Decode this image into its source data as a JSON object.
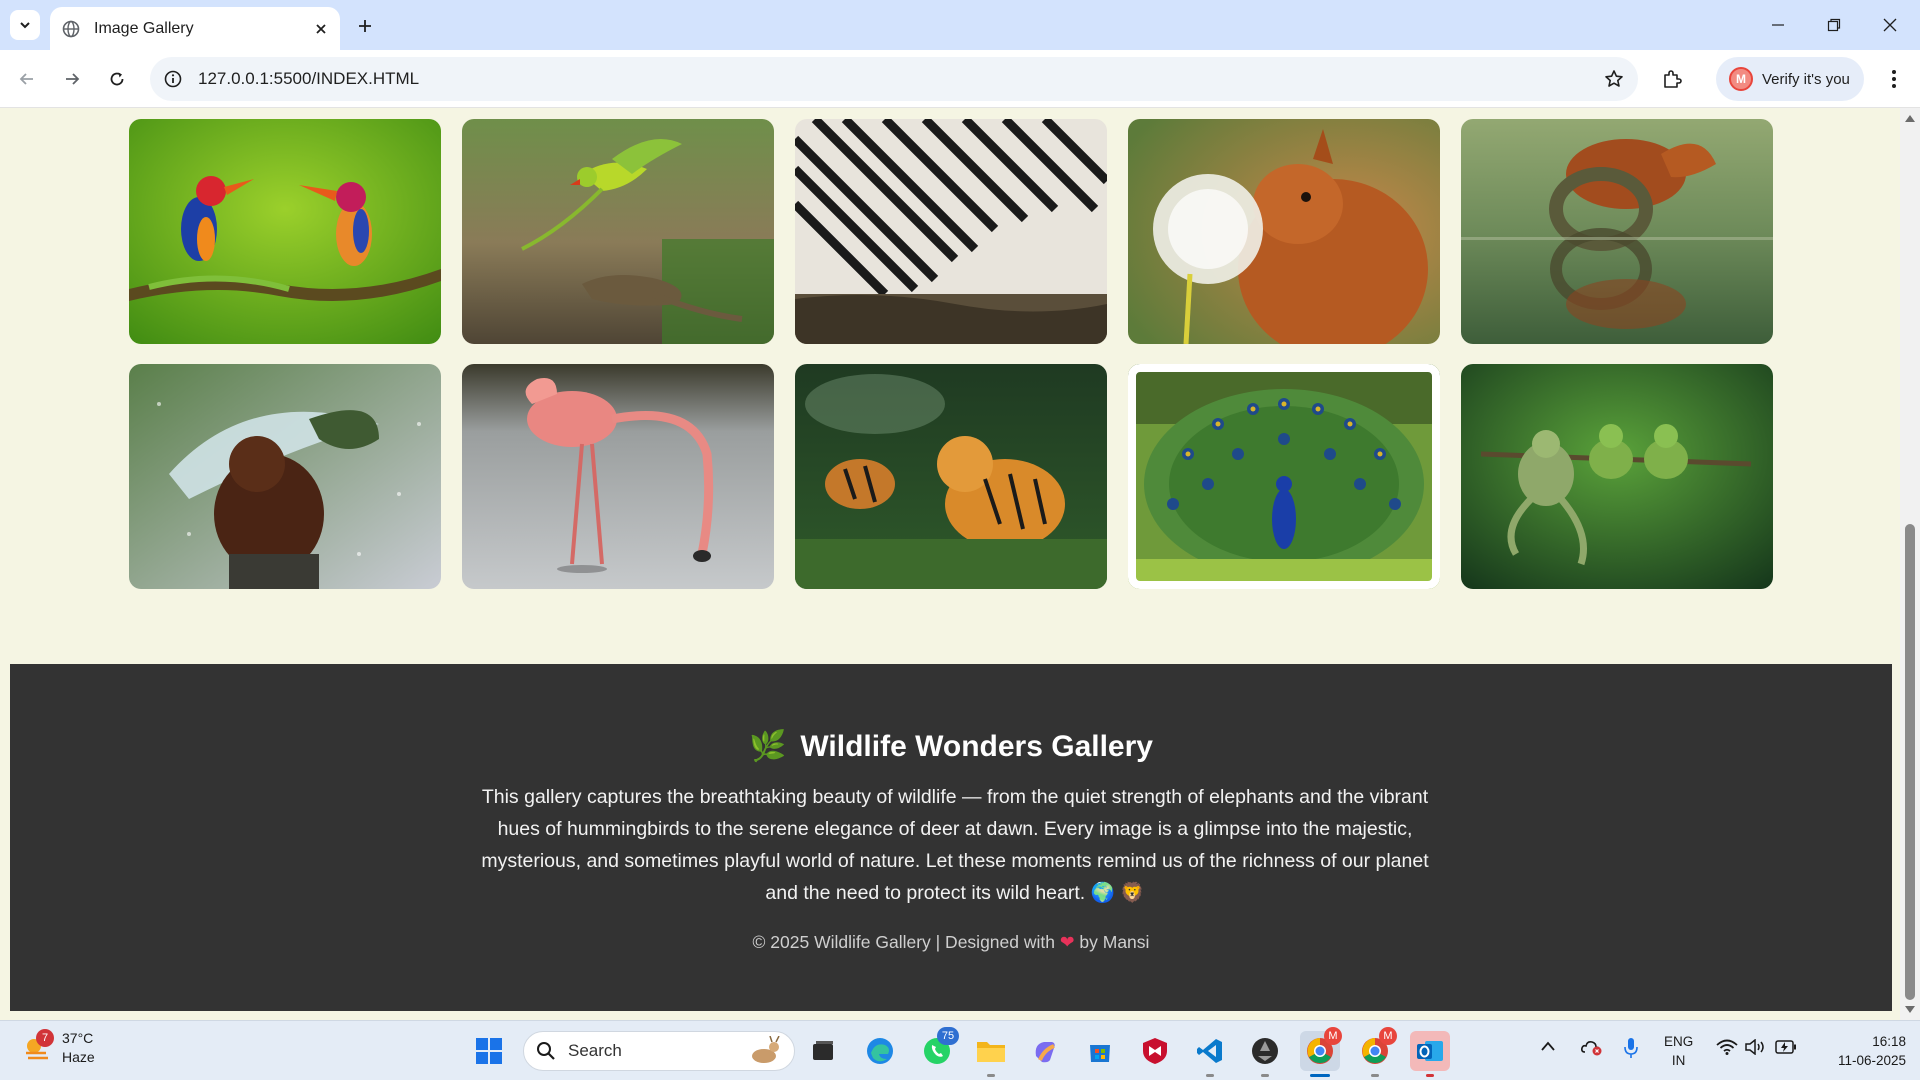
{
  "browser": {
    "tab_title": "Image Gallery",
    "url": "127.0.0.1:5500/INDEX.HTML",
    "profile_label": "Verify it's you",
    "profile_initial": "M"
  },
  "gallery": {
    "images": [
      {
        "subject": "kingfishers-on-branch"
      },
      {
        "subject": "parrot-and-lizard"
      },
      {
        "subject": "zebras-drinking"
      },
      {
        "subject": "squirrel-with-dandelion"
      },
      {
        "subject": "squirrel-reflection"
      },
      {
        "subject": "orangutan-with-leaf"
      },
      {
        "subject": "flamingo-in-water"
      },
      {
        "subject": "tigers-fighting"
      },
      {
        "subject": "peacock-feathers"
      },
      {
        "subject": "frogs-on-stick"
      }
    ]
  },
  "footer": {
    "title_emoji": "🌿",
    "title": "Wildlife Wonders Gallery",
    "description": "This gallery captures the breathtaking beauty of wildlife — from the quiet strength of elephants and the vibrant hues of hummingbirds to the serene elegance of deer at dawn. Every image is a glimpse into the majestic, mysterious, and sometimes playful world of nature. Let these moments remind us of the richness of our planet and the need to protect its wild heart. 🌍 🦁",
    "credit_prefix": "© 2025 Wildlife Gallery | Designed with",
    "credit_heart": "❤",
    "credit_suffix": "by Mansi"
  },
  "taskbar": {
    "weather_temp": "37°C",
    "weather_desc": "Haze",
    "weather_badge": "7",
    "search_placeholder": "Search",
    "whatsapp_badge": "75",
    "chrome_badge_initial": "M",
    "lang_line1": "ENG",
    "lang_line2": "IN",
    "time": "16:18",
    "date": "11-06-2025"
  },
  "colors": {
    "page_bg": "#f5f5e3",
    "footer_bg": "#333333",
    "tab_strip": "#d3e3fd",
    "accent": "#0067c0"
  }
}
